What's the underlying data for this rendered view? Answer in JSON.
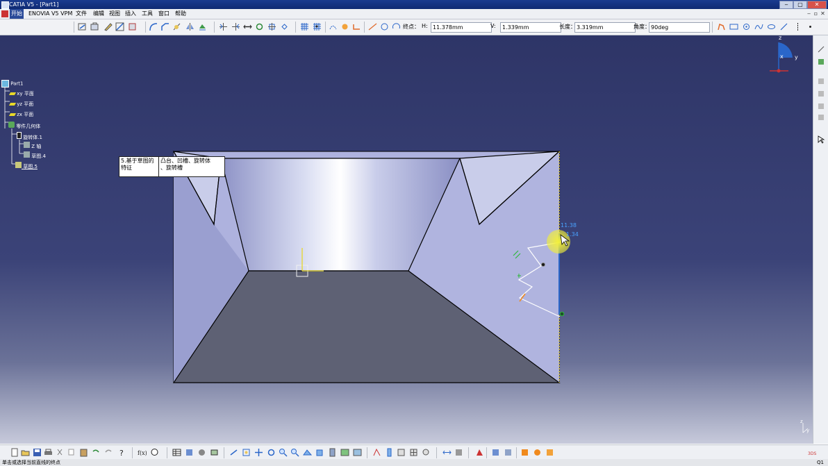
{
  "window": {
    "title": "CATIA V5 - [Part1]",
    "min": "‒",
    "max": "▢",
    "close": "✕"
  },
  "menu": {
    "items": [
      "开始",
      "ENOVIA V5 VPM",
      "文件",
      "编辑",
      "视图",
      "插入",
      "工具",
      "窗口",
      "帮助"
    ],
    "doc_controls": [
      "‒",
      "▫",
      "✕"
    ]
  },
  "sketch_tools": {
    "endpoint_label": "终点：",
    "h_label": "H:",
    "h_value": "11.378mm",
    "v_label": "V:",
    "v_value": "1.339mm",
    "length_label": "长度：",
    "length_value": "3.319mm",
    "angle_label": "角度：",
    "angle_value": "90deg"
  },
  "tree": {
    "root": "Part1",
    "items": [
      "xy 平面",
      "yz 平面",
      "zx 平面",
      "零件几何体",
      "旋转体.1",
      "Z 轴",
      "草图.4",
      "草图.5"
    ]
  },
  "tooltip": {
    "left": [
      "5.基于草图的",
      "特征"
    ],
    "right": [
      "凸台、凹槽、旋转体",
      "、旋转槽"
    ]
  },
  "viewport": {
    "dimension_values": [
      "11.38",
      "1.34"
    ],
    "compass_labels": {
      "z": "z",
      "x": "x",
      "y": "y"
    },
    "corner_axis": {
      "y": "y",
      "z": "z"
    },
    "colors": {
      "face_light": "#d9ddf2",
      "face_left": "#9a9fd0",
      "face_right": "#aeb2de",
      "face_bottom": "#5e6174",
      "highlight": "#f2ef3a",
      "sketch_profile": "#ffffff",
      "constraint_green": "#2eb83b",
      "constraint_orange": "#f08a1e"
    }
  },
  "status": {
    "text": "单击或选择当前直线的终点",
    "right": "Q1"
  }
}
